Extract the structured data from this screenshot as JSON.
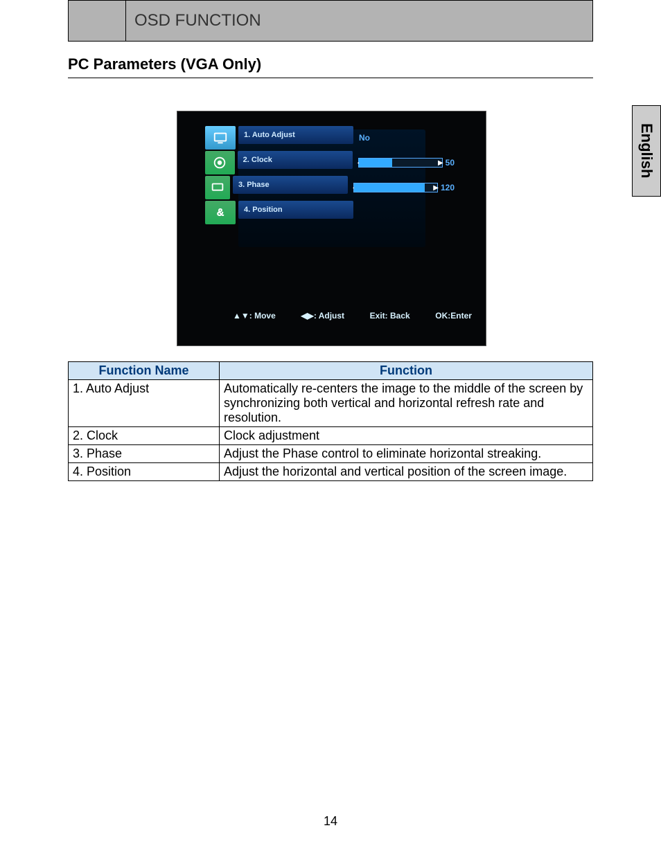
{
  "header": {
    "title": "OSD FUNCTION"
  },
  "section_heading": "PC Parameters (VGA Only)",
  "language_tab": "English",
  "osd": {
    "menu_items": [
      {
        "label": "1. Auto Adjust",
        "value_text": "No",
        "type": "text"
      },
      {
        "label": "2. Clock",
        "value_text": "50",
        "type": "slider",
        "pct": 40
      },
      {
        "label": "3. Phase",
        "value_text": "120",
        "type": "slider",
        "pct": 85
      },
      {
        "label": "4. Position",
        "type": "none"
      }
    ],
    "hints": {
      "move": "▲▼: Move",
      "adjust": "◀▶: Adjust",
      "exit": "Exit: Back",
      "ok": "OK:Enter"
    }
  },
  "table": {
    "headers": {
      "name": "Function Name",
      "desc": "Function"
    },
    "rows": [
      {
        "name": "1. Auto Adjust",
        "desc": "Automatically re-centers the image to the middle of the screen by synchronizing both vertical and horizontal refresh rate and resolution."
      },
      {
        "name": "2. Clock",
        "desc": "Clock adjustment"
      },
      {
        "name": "3. Phase",
        "desc": "Adjust the Phase control to eliminate horizontal streaking."
      },
      {
        "name": "4. Position",
        "desc": "Adjust the horizontal and vertical position of the screen image."
      }
    ]
  },
  "page_number": "14"
}
